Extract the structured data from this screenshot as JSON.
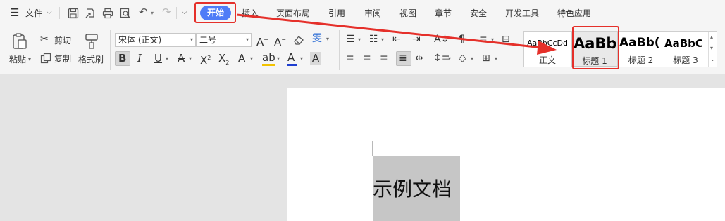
{
  "menubar": {
    "file_label": "文件",
    "tabs": [
      "开始",
      "插入",
      "页面布局",
      "引用",
      "审阅",
      "视图",
      "章节",
      "安全",
      "开发工具",
      "特色应用"
    ]
  },
  "ribbon": {
    "paste_label": "粘贴",
    "cut_label": "剪切",
    "copy_label": "复制",
    "format_painter_label": "格式刷",
    "font_name": "宋体 (正文)",
    "font_size": "二号",
    "styles": [
      {
        "sample": "AaBbCcDd",
        "label": "正文"
      },
      {
        "sample": "AaBb",
        "label": "标题 1"
      },
      {
        "sample": "AaBb(",
        "label": "标题 2"
      },
      {
        "sample": "AaBbC",
        "label": "标题 3"
      }
    ]
  },
  "document": {
    "selected_text": "示例文档"
  },
  "colors": {
    "accent": "#4f7cf7",
    "annotation_red": "#e5302a",
    "font_color_bar": "#1f3fd0",
    "highlight_bar": "#f2c200",
    "selection_gray": "#c6c6c6"
  }
}
